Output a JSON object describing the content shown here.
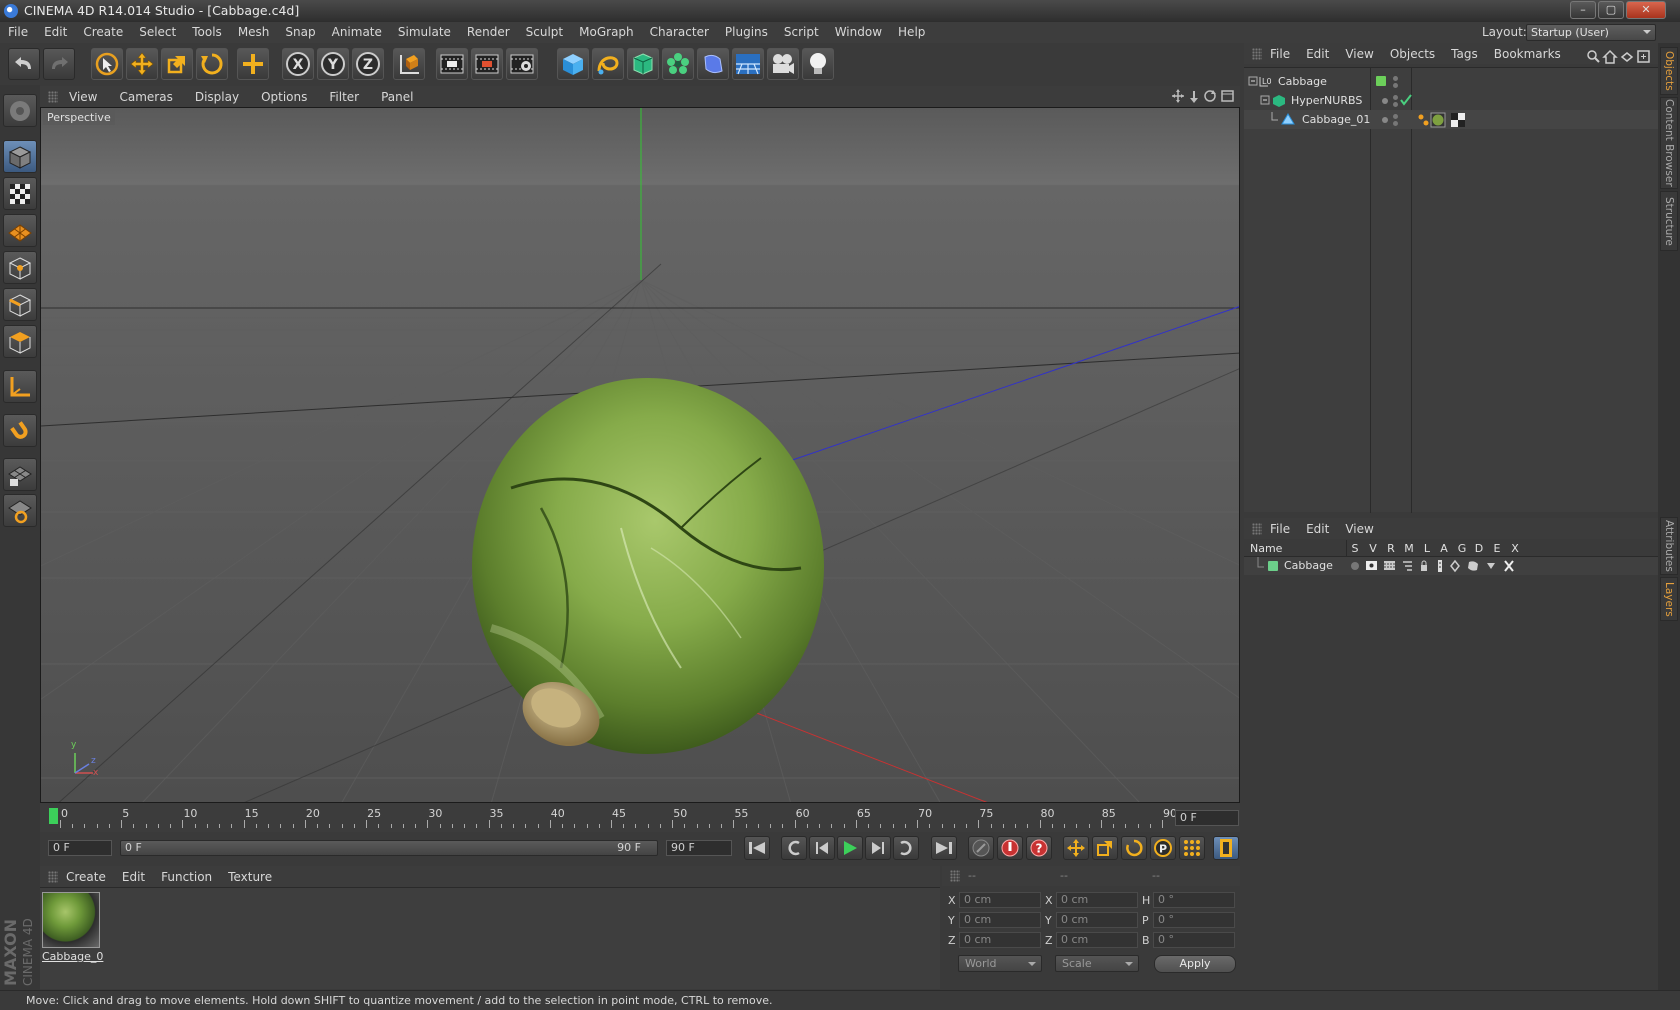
{
  "window": {
    "title": "CINEMA 4D R14.014 Studio - [Cabbage.c4d]",
    "min": "–",
    "max": "▢",
    "close": "✕"
  },
  "menu": [
    "File",
    "Edit",
    "Create",
    "Select",
    "Tools",
    "Mesh",
    "Snap",
    "Animate",
    "Simulate",
    "Render",
    "Sculpt",
    "MoGraph",
    "Character",
    "Plugins",
    "Script",
    "Window",
    "Help"
  ],
  "layout": {
    "label": "Layout:",
    "value": "Startup (User)"
  },
  "viewport": {
    "menu": [
      "View",
      "Cameras",
      "Display",
      "Options",
      "Filter",
      "Panel"
    ],
    "label": "Perspective",
    "axis": {
      "x": "x",
      "y": "y",
      "z": "z"
    }
  },
  "timeline": {
    "ticks": [
      "0",
      "5",
      "10",
      "15",
      "20",
      "25",
      "30",
      "35",
      "40",
      "45",
      "50",
      "55",
      "60",
      "65",
      "70",
      "75",
      "80",
      "85",
      "90"
    ],
    "current_frame": "0 F",
    "start": "0 F",
    "slider_start": "0 F",
    "slider_end": "90 F",
    "end": "90 F"
  },
  "materials": {
    "menu": [
      "Create",
      "Edit",
      "Function",
      "Texture"
    ],
    "items": [
      {
        "name": "Cabbage_0"
      }
    ]
  },
  "coords": {
    "headers": [
      "--",
      "--",
      "--"
    ],
    "rows": [
      {
        "a": "X",
        "av": "0 cm",
        "b": "X",
        "bv": "0 cm",
        "c": "H",
        "cv": "0 °"
      },
      {
        "a": "Y",
        "av": "0 cm",
        "b": "Y",
        "bv": "0 cm",
        "c": "P",
        "cv": "0 °"
      },
      {
        "a": "Z",
        "av": "0 cm",
        "b": "Z",
        "bv": "0 cm",
        "c": "B",
        "cv": "0 °"
      }
    ],
    "space": "World",
    "mode": "Scale",
    "apply": "Apply"
  },
  "objects": {
    "menu": [
      "File",
      "Edit",
      "View",
      "Objects",
      "Tags",
      "Bookmarks"
    ],
    "tree": [
      {
        "name": "Cabbage"
      },
      {
        "name": "HyperNURBS"
      },
      {
        "name": "Cabbage_01"
      }
    ]
  },
  "layers": {
    "menu": [
      "File",
      "Edit",
      "View"
    ],
    "columns": {
      "name": "Name",
      "flags": [
        "S",
        "V",
        "R",
        "M",
        "L",
        "A",
        "G",
        "D",
        "E",
        "X"
      ]
    },
    "rows": [
      {
        "name": "Cabbage",
        "color": "#6ccf8a"
      }
    ]
  },
  "side_tabs": {
    "objects": "Objects",
    "content": "Content Browser",
    "structure": "Structure",
    "attributes": "Attributes",
    "layers": "Layers"
  },
  "branding": {
    "maxon": "MAXON",
    "product": "CINEMA 4D"
  },
  "status": "Move: Click and drag to move elements. Hold down SHIFT to quantize movement / add to the selection in point mode, CTRL to remove.",
  "colors": {
    "accent": "#e6a03c",
    "selection": "#4a78b0",
    "axis_x": "#c83232",
    "axis_y": "#32c832",
    "axis_z": "#3232c8"
  },
  "icons": {
    "toolbar": [
      "undo-icon",
      "redo-icon",
      "live-select-icon",
      "move-icon",
      "scale-icon",
      "rotate-icon",
      "add-icon",
      "lock-x-icon",
      "lock-y-icon",
      "lock-z-icon",
      "coordinate-system-icon",
      "render-view-icon",
      "render-picture-viewer-icon",
      "edit-render-settings-icon",
      "cube-icon",
      "spline-icon",
      "nurbs-icon",
      "mograph-cloner-icon",
      "deformer-icon",
      "floor-icon",
      "camera-icon",
      "light-icon"
    ],
    "left": [
      "make-editable-icon",
      "model-mode-icon",
      "texture-mode-icon",
      "workplane-mode-icon",
      "points-mode-icon",
      "edges-mode-icon",
      "polygons-mode-icon",
      "axis-mode-icon",
      "snap-magnet-icon",
      "locked-workplane-icon",
      "planar-workplane-icon"
    ]
  }
}
